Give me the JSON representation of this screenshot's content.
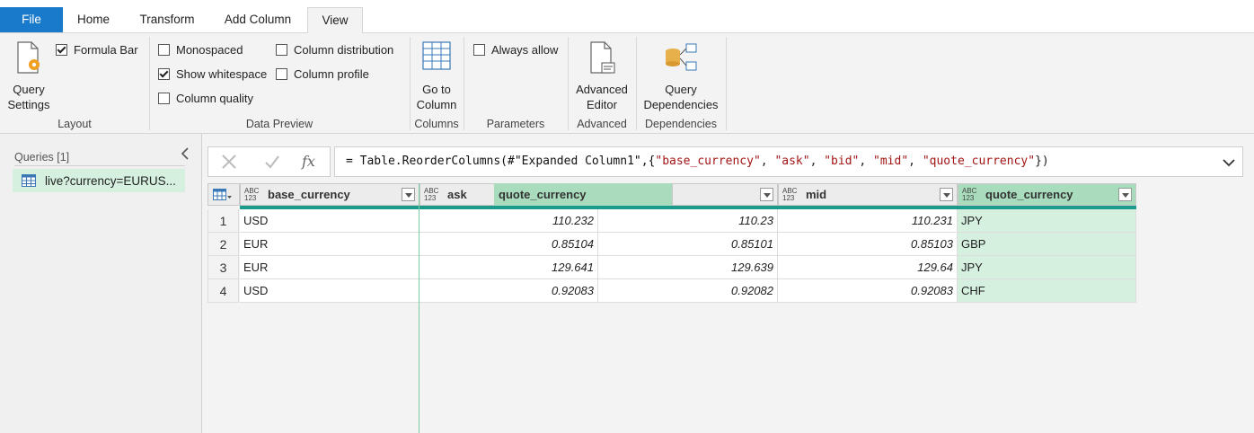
{
  "tabs": [
    {
      "label": "File"
    },
    {
      "label": "Home"
    },
    {
      "label": "Transform"
    },
    {
      "label": "Add Column"
    },
    {
      "label": "View"
    }
  ],
  "ribbon": {
    "layout": {
      "query_settings_label": "Query Settings",
      "formula_bar": {
        "label": "Formula Bar",
        "checked": true
      },
      "group_label": "Layout"
    },
    "data_preview": {
      "monospaced": {
        "label": "Monospaced",
        "checked": false
      },
      "show_whitespace": {
        "label": "Show whitespace",
        "checked": true
      },
      "column_quality": {
        "label": "Column quality",
        "checked": false
      },
      "column_distribution": {
        "label": "Column distribution",
        "checked": false
      },
      "column_profile": {
        "label": "Column profile",
        "checked": false
      },
      "group_label": "Data Preview"
    },
    "columns": {
      "go_to_column_label": "Go to Column",
      "group_label": "Columns"
    },
    "parameters": {
      "always_allow": {
        "label": "Always allow",
        "checked": false
      },
      "group_label": "Parameters"
    },
    "advanced": {
      "advanced_editor_label": "Advanced Editor",
      "group_label": "Advanced"
    },
    "dependencies": {
      "query_dependencies_label": "Query Dependencies",
      "group_label": "Dependencies"
    }
  },
  "queries": {
    "title": "Queries [1]",
    "items": [
      {
        "label": "live?currency=EURUS..."
      }
    ]
  },
  "formula": {
    "prefix": "= Table.ReorderColumns(#\"Expanded Column1\",{",
    "args": [
      "\"base_currency\"",
      "\"ask\"",
      "\"bid\"",
      "\"mid\"",
      "\"quote_currency\""
    ],
    "suffix": "})",
    "fx_label": "fx"
  },
  "grid": {
    "type_badge": "ABC\n123",
    "columns": [
      {
        "name": "base_currency"
      },
      {
        "name": "ask"
      },
      {
        "name": "quote_currency"
      },
      {
        "name": "mid"
      },
      {
        "name": "quote_currency"
      }
    ],
    "rows": [
      {
        "num": "1",
        "base_currency": "USD",
        "ask": "110.232",
        "bid": "110.23",
        "mid": "110.231",
        "quote_currency": "JPY"
      },
      {
        "num": "2",
        "base_currency": "EUR",
        "ask": "0.85104",
        "bid": "0.85101",
        "mid": "0.85103",
        "quote_currency": "GBP"
      },
      {
        "num": "3",
        "base_currency": "EUR",
        "ask": "129.641",
        "bid": "129.639",
        "mid": "129.64",
        "quote_currency": "JPY"
      },
      {
        "num": "4",
        "base_currency": "USD",
        "ask": "0.92083",
        "bid": "0.92082",
        "mid": "0.92083",
        "quote_currency": "CHF"
      }
    ]
  },
  "colors": {
    "file_tab": "#1979ca",
    "selected_column": "#d6f0e0",
    "quality_bar": "#1a9b8c",
    "string_literal": "#a31515"
  }
}
